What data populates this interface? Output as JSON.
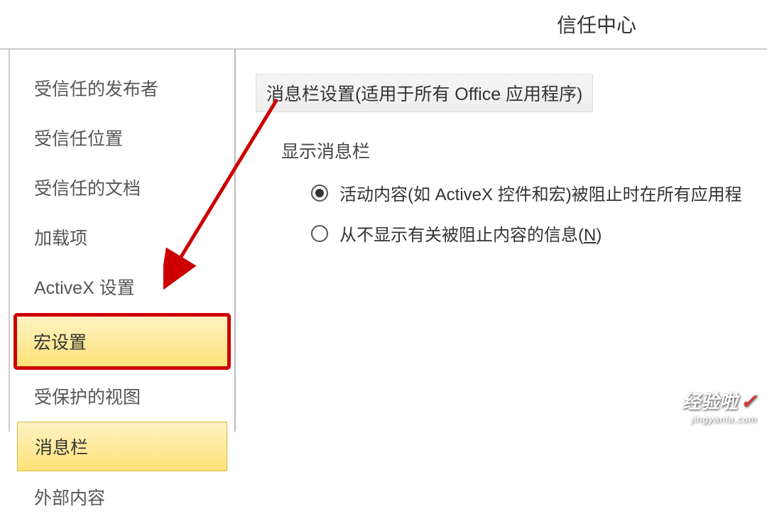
{
  "title": "信任中心",
  "sidebar": {
    "items": [
      {
        "label": "受信任的发布者"
      },
      {
        "label": "受信任位置"
      },
      {
        "label": "受信任的文档"
      },
      {
        "label": "加载项"
      },
      {
        "label": "ActiveX 设置"
      },
      {
        "label": "宏设置"
      },
      {
        "label": "受保护的视图"
      },
      {
        "label": "消息栏"
      },
      {
        "label": "外部内容"
      }
    ]
  },
  "content": {
    "section_title": "消息栏设置(适用于所有 Office 应用程序)",
    "subsection_label": "显示消息栏",
    "radio1": "活动内容(如 ActiveX 控件和宏)被阻止时在所有应用程",
    "radio2_pre": "从不显示有关被阻止内容的信息(",
    "radio2_key": "N",
    "radio2_post": ")"
  },
  "watermark": {
    "main": "经验啦",
    "sub": "jingyanla.com"
  }
}
